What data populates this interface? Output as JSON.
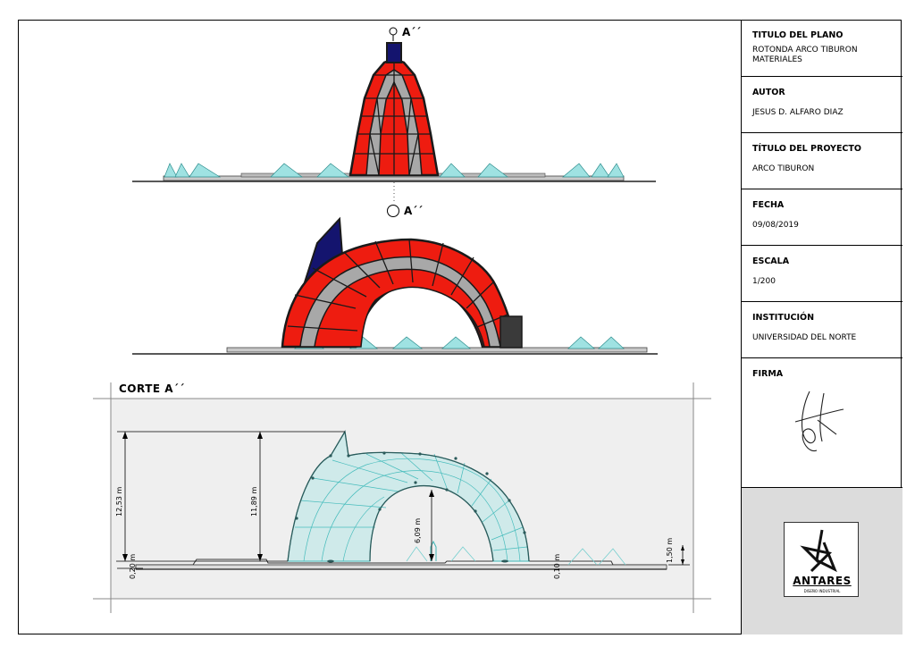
{
  "titleblock": {
    "titulo_plano": {
      "label": "TITULO DEL PLANO",
      "value": "ROTONDA ARCO TIBURON\nMATERIALES"
    },
    "autor": {
      "label": "AUTOR",
      "value": "JESUS D. ALFARO DIAZ"
    },
    "titulo_proyecto": {
      "label": "TÍTULO DEL PROYECTO",
      "value": "ARCO TIBURON"
    },
    "fecha": {
      "label": "FECHA",
      "value": "09/08/2019"
    },
    "escala": {
      "label": "ESCALA",
      "value": "1/200"
    },
    "institucion": {
      "label": "INSTITUCIÓN",
      "value": "UNIVERSIDAD DEL NORTE"
    },
    "firma": {
      "label": "FIRMA"
    },
    "logo": {
      "name": "ANTARES",
      "subtitle": "DISEÑO INDUSTRIAL"
    }
  },
  "section_marks": {
    "top": "A´´",
    "middle": "A´´"
  },
  "corte": {
    "title": "CORTE A´´"
  },
  "dimensions": {
    "overall_height": "12,53 m",
    "arch_height": "11,89 m",
    "inner_height": "6,09 m",
    "base_left": "0,20 m",
    "base_right": "0,10 m",
    "side_height": "1,50 m"
  },
  "colors": {
    "red": "#ee1c10",
    "grey": "#a8a8a8",
    "navy": "#14146e",
    "cyan": "#6fd0d0"
  }
}
